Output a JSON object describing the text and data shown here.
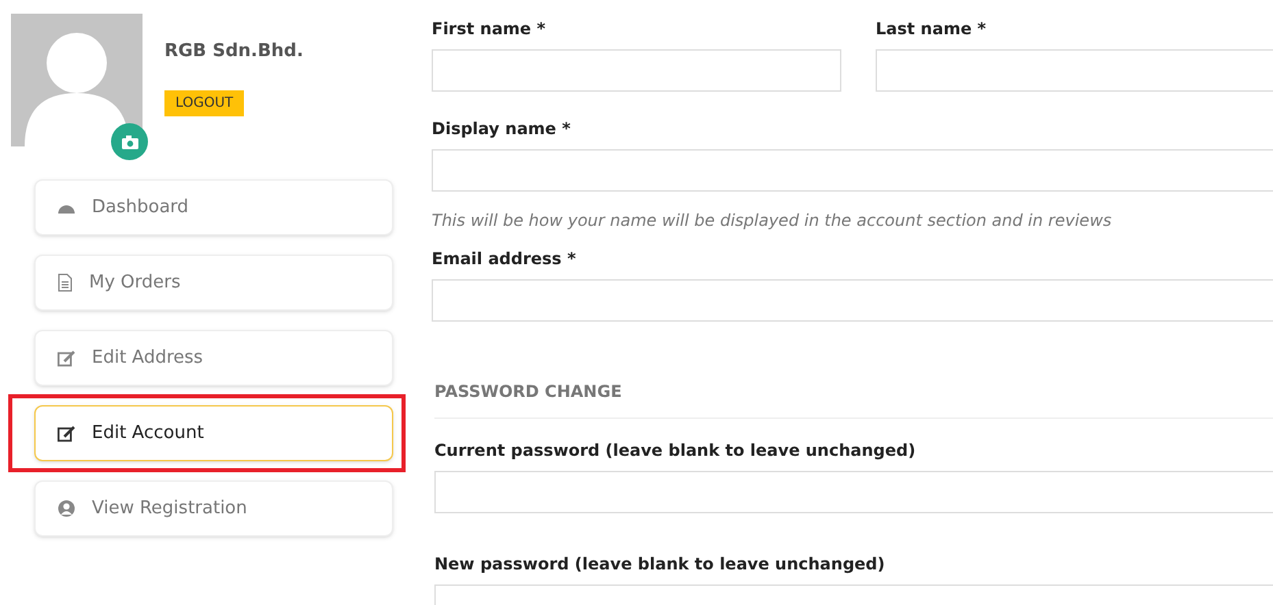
{
  "profile": {
    "name": "RGB Sdn.Bhd.",
    "logout": "LOGOUT"
  },
  "nav": [
    {
      "label": "Dashboard",
      "selected": false,
      "annotated": false
    },
    {
      "label": "My Orders",
      "selected": false,
      "annotated": false
    },
    {
      "label": "Edit Address",
      "selected": false,
      "annotated": false
    },
    {
      "label": "Edit Account",
      "selected": true,
      "annotated": true
    },
    {
      "label": "View Registration",
      "selected": false,
      "annotated": false
    }
  ],
  "form": {
    "row": [
      {
        "label": "First name *"
      },
      {
        "label": "Last name *"
      }
    ],
    "display_name": {
      "label": "Display name *",
      "hint": "This will be how your name will be displayed in the account section and in reviews"
    },
    "email": {
      "label": "Email address *"
    },
    "password_heading": "PASSWORD CHANGE",
    "passwords": [
      {
        "label": "Current password (leave blank to leave unchanged)"
      },
      {
        "label": "New password (leave blank to leave unchanged)"
      }
    ]
  }
}
